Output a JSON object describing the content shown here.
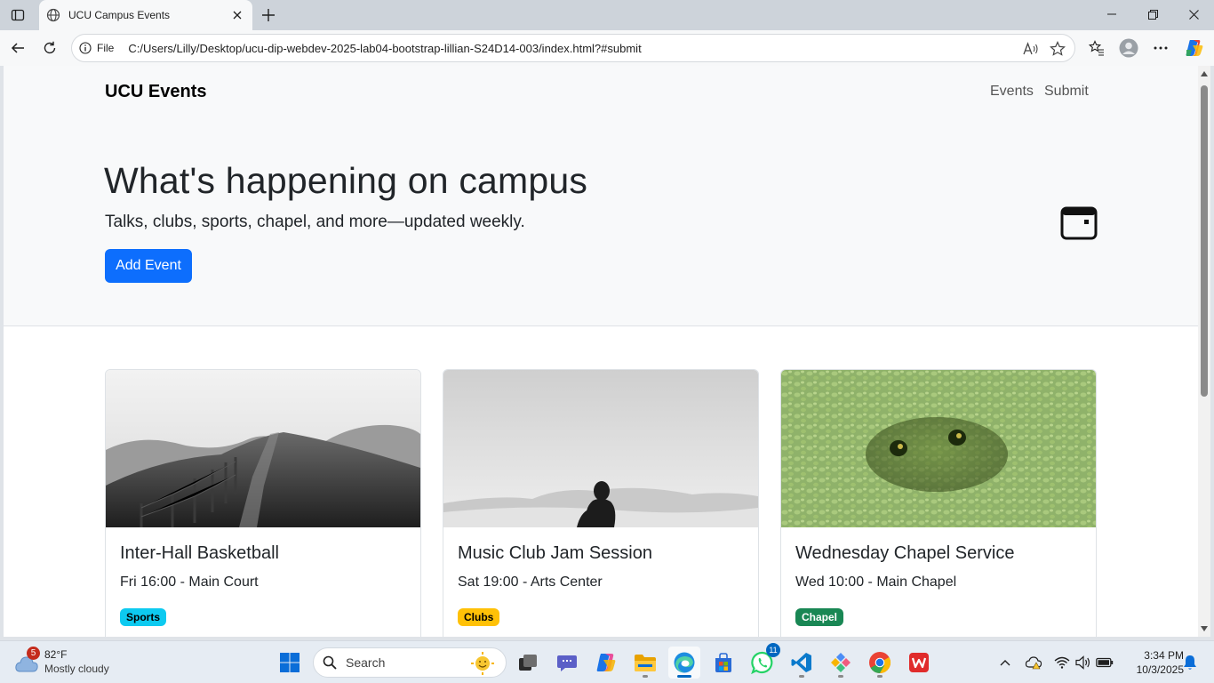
{
  "browser": {
    "tab_title": "UCU Campus Events",
    "site_info_label": "File",
    "url": "C:/Users/Lilly/Desktop/ucu-dip-webdev-2025-lab04-bootstrap-lillian-S24D14-003/index.html?#submit"
  },
  "page": {
    "brand": "UCU Events",
    "nav": {
      "events": "Events",
      "submit": "Submit"
    },
    "hero": {
      "title": "What's happening on campus",
      "subtitle": "Talks, clubs, sports, chapel, and more—updated weekly.",
      "button": "Add Event",
      "icon": "calendar-icon"
    },
    "cards": [
      {
        "title": "Inter-Hall Basketball",
        "meta": "Fri 16:00 - Main Court",
        "badge": "Sports",
        "badge_color": "#0dcaf0",
        "badge_text_color": "#000000",
        "image": "grayscale hills with fence"
      },
      {
        "title": "Music Club Jam Session",
        "meta": "Sat 19:00 - Arts Center",
        "badge": "Clubs",
        "badge_color": "#ffc107",
        "badge_text_color": "#000000",
        "image": "grayscale desert silhouette"
      },
      {
        "title": "Wednesday Chapel Service",
        "meta": "Wed 10:00 - Main Chapel",
        "badge": "Chapel",
        "badge_color": "#198754",
        "badge_text_color": "#ffffff",
        "image": "frog in duckweed"
      }
    ]
  },
  "taskbar": {
    "weather": {
      "badge": "5",
      "temp": "82°F",
      "desc": "Mostly cloudy"
    },
    "search_label": "Search",
    "whatsapp_badge": "11",
    "time": "3:34 PM",
    "date": "10/3/2025"
  },
  "colors": {
    "primary": "#0d6efd",
    "hero_bg": "#f8f9fa"
  }
}
